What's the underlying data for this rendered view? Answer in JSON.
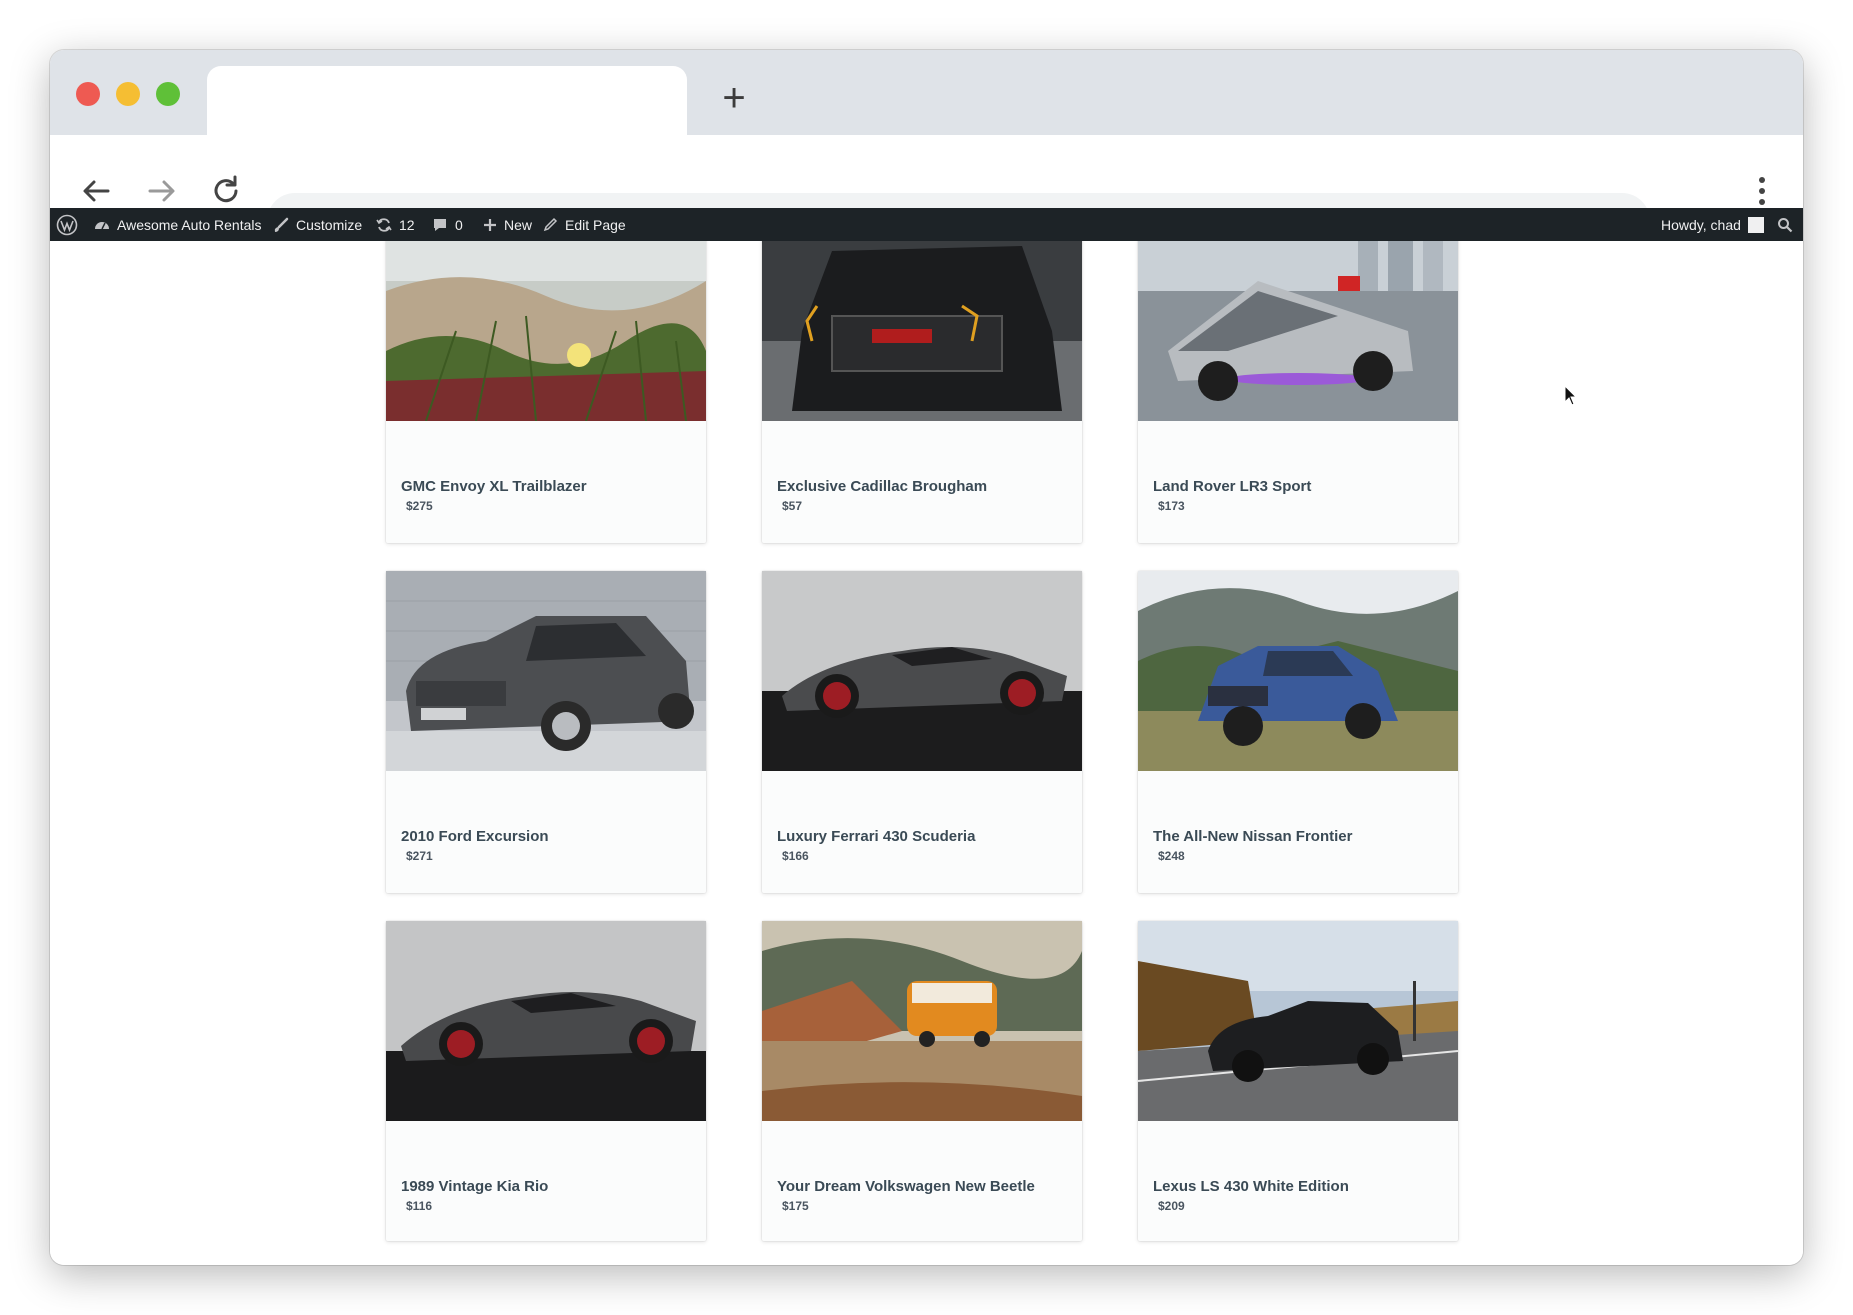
{
  "browser": {
    "new_tab_label": "+",
    "address": ""
  },
  "adminbar": {
    "site_name": "Awesome Auto Rentals",
    "customize": "Customize",
    "updates_count": "12",
    "comments_count": "0",
    "new_label": "New",
    "edit_page": "Edit Page",
    "howdy": "Howdy, chad"
  },
  "listings": [
    {
      "title": "GMC Envoy XL Trailblazer",
      "price": "$275",
      "image": "grass-dune-photo"
    },
    {
      "title": "Exclusive Cadillac Brougham",
      "price": "$57",
      "image": "black-gmc-truck-photo"
    },
    {
      "title": "Land Rover LR3 Sport",
      "price": "$173",
      "image": "cybertruck-photo"
    },
    {
      "title": "2010 Ford Excursion",
      "price": "$271",
      "image": "gray-hatchback-photo"
    },
    {
      "title": "Luxury Ferrari 430 Scuderia",
      "price": "$166",
      "image": "gray-supercar-photo"
    },
    {
      "title": "The All-New Nissan Frontier",
      "price": "$248",
      "image": "blue-suv-mountains-photo"
    },
    {
      "title": "1989 Vintage Kia Rio",
      "price": "$116",
      "image": "gray-supercar-photo"
    },
    {
      "title": "Your Dream Volkswagen New Beetle",
      "price": "$175",
      "image": "orange-vw-bus-photo"
    },
    {
      "title": "Lexus LS 430 White Edition",
      "price": "$209",
      "image": "black-lexus-road-photo"
    }
  ]
}
